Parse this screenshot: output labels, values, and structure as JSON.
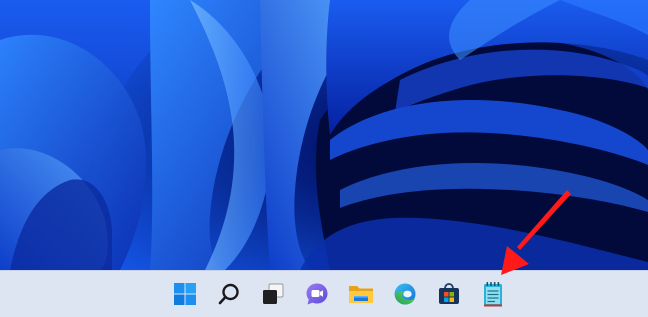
{
  "desktop": {
    "wallpaper": "windows-11-bloom",
    "colors": {
      "base": "#0a2fae",
      "dark": "#020a3c",
      "light": "#3f8dff"
    }
  },
  "taskbar": {
    "background": "#dde5f3",
    "items": [
      {
        "name": "start-button",
        "icon": "windows-logo-icon"
      },
      {
        "name": "search-button",
        "icon": "search-icon"
      },
      {
        "name": "task-view-button",
        "icon": "task-view-icon"
      },
      {
        "name": "chat-button",
        "icon": "teams-chat-icon"
      },
      {
        "name": "file-explorer-button",
        "icon": "folder-icon"
      },
      {
        "name": "edge-button",
        "icon": "edge-icon"
      },
      {
        "name": "store-button",
        "icon": "store-icon"
      },
      {
        "name": "notepad-button",
        "icon": "notepad-icon"
      }
    ]
  },
  "annotation": {
    "type": "red-arrow",
    "points_to": "notepad-button",
    "color": "#ff1a1a"
  }
}
